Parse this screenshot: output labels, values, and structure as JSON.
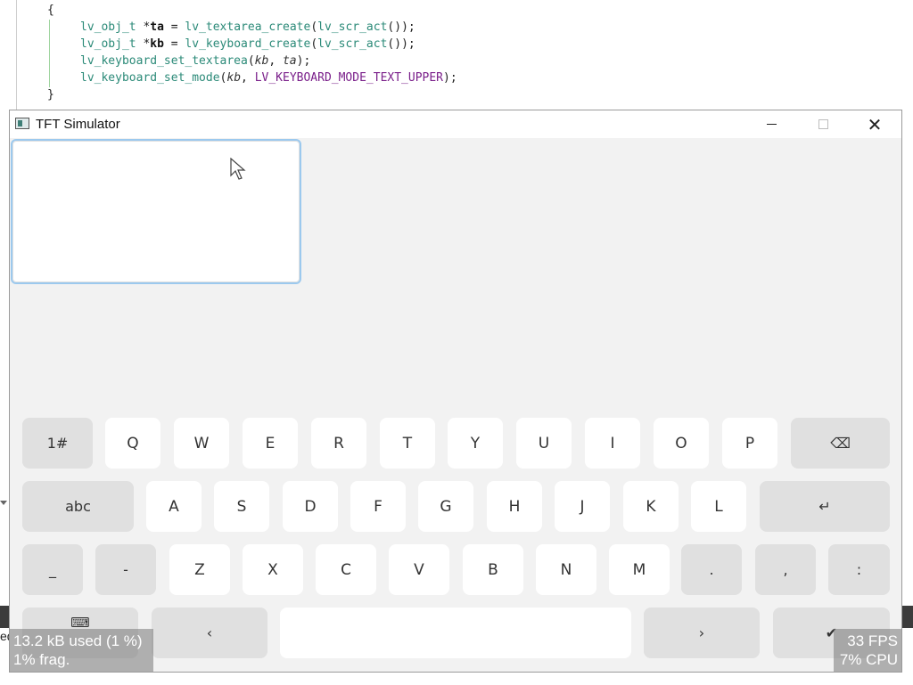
{
  "editor": {
    "line1": "{",
    "line2_type": "lv_obj_t",
    "line2_star": " *",
    "line2_var": "ta",
    "line2_rest": " = ",
    "line2_fn": "lv_textarea_create",
    "line2_args": "(",
    "line2_arg_fn": "lv_scr_act",
    "line2_end": "());",
    "line3_type": "lv_obj_t",
    "line3_star": " *",
    "line3_var": "kb",
    "line3_rest": " = ",
    "line3_fn": "lv_keyboard_create",
    "line3_args": "(",
    "line3_arg_fn": "lv_scr_act",
    "line3_end": "());",
    "line4_fn": "lv_keyboard_set_textarea",
    "line4_open": "(",
    "line4_p1": "kb",
    "line4_sep": ", ",
    "line4_p2": "ta",
    "line4_end": ");",
    "line5_fn": "lv_keyboard_set_mode",
    "line5_open": "(",
    "line5_p1": "kb",
    "line5_sep": ", ",
    "line5_const": "LV_KEYBOARD_MODE_TEXT_UPPER",
    "line5_end": ");",
    "line6": "}",
    "side_left_text": "ed"
  },
  "window": {
    "title": "TFT Simulator",
    "minimize_glyph": "",
    "close_glyph": "✕"
  },
  "keyboard": {
    "row1": [
      "1#",
      "Q",
      "W",
      "E",
      "R",
      "T",
      "Y",
      "U",
      "I",
      "O",
      "P",
      "⌫"
    ],
    "row2": [
      "abc",
      "A",
      "S",
      "D",
      "F",
      "G",
      "H",
      "J",
      "K",
      "L",
      "↵"
    ],
    "row3": [
      "_",
      "-",
      "Z",
      "X",
      "C",
      "V",
      "B",
      "N",
      "M",
      ".",
      ",",
      ":"
    ],
    "row4": [
      "⌨",
      "‹",
      "",
      "›",
      "✔"
    ]
  },
  "overlay": {
    "mem_line1": "13.2 kB used (1 %)",
    "mem_line2": "1% frag.",
    "fps_line1": "33 FPS",
    "fps_line2": "7% CPU"
  },
  "colors": {
    "screen_bg": "#f2f2f2",
    "key_light": "#ffffff",
    "key_dark": "#e0e0e0",
    "textarea_focus_border": "#9cc9ee"
  }
}
